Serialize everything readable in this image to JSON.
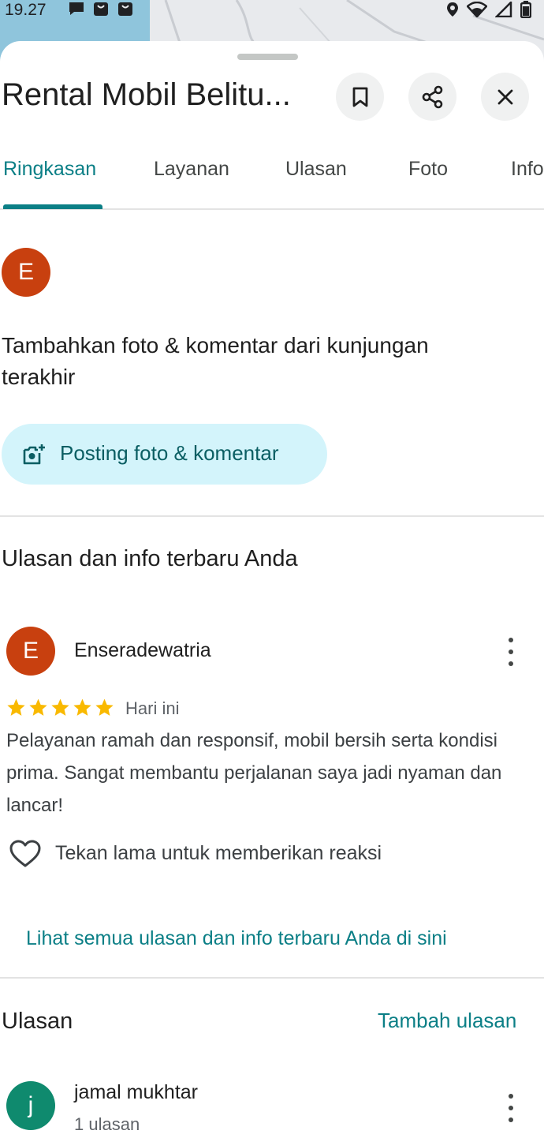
{
  "status_bar": {
    "time": "19.27",
    "left_icons": [
      "chat-bubble-icon",
      "shopping-bag-icon",
      "shopping-bag-icon"
    ],
    "right_icons": [
      "location-pin-icon",
      "wifi-icon",
      "signal-icon",
      "battery-icon"
    ]
  },
  "place": {
    "title": "Rental Mobil Belitu...",
    "actions": [
      {
        "name": "save",
        "icon": "bookmark-icon"
      },
      {
        "name": "share",
        "icon": "share-icon"
      },
      {
        "name": "close",
        "icon": "close-icon"
      }
    ]
  },
  "tabs": [
    "Ringkasan",
    "Layanan",
    "Ulasan",
    "Foto",
    "Info"
  ],
  "active_tab": "Ringkasan",
  "contribute": {
    "avatar_letter": "E",
    "prompt": "Tambahkan foto & komentar dari kunjungan terakhir",
    "button_label": "Posting foto & komentar"
  },
  "your_reviews": {
    "title": "Ulasan dan info terbaru Anda",
    "review": {
      "avatar_letter": "E",
      "author": "Enseradewatria",
      "rating": 5,
      "date": "Hari ini",
      "text": "Pelayanan ramah dan responsif, mobil bersih serta kondisi prima. Sangat membantu perjalanan saya jadi nyaman dan lancar!",
      "reaction_hint": "Tekan lama untuk memberikan reaksi"
    },
    "see_all_link": "Lihat semua ulasan dan info terbaru Anda di sini"
  },
  "reviews": {
    "title": "Ulasan",
    "add_label": "Tambah ulasan",
    "first": {
      "avatar_letter": "j",
      "author": "jamal mukhtar",
      "count": "1 ulasan"
    }
  },
  "colors": {
    "accent": "#0b7f86",
    "avatar_red": "#c8400f",
    "avatar_green": "#0f8a6e",
    "star": "#f9b900",
    "post_button_bg": "#d3f4fb"
  }
}
